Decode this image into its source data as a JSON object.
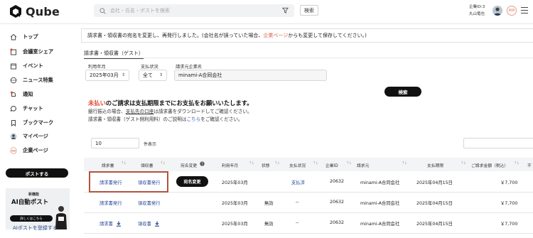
{
  "header": {
    "brand": "Qube",
    "search_placeholder": "会社・氏名・ポストを検索",
    "search_button": "検索",
    "company_line": "企業ID:3",
    "user_name": "丸山竜也",
    "avatar_initials": "AW"
  },
  "sidebar": {
    "items": [
      {
        "label": "トップ",
        "icon": "home-icon"
      },
      {
        "label": "会議室シェア",
        "icon": "meeting-room-icon"
      },
      {
        "label": "イベント",
        "icon": "calendar-icon"
      },
      {
        "label": "ニュース特集",
        "icon": "globe-icon"
      },
      {
        "label": "通知",
        "icon": "bell-icon"
      },
      {
        "label": "チャット",
        "icon": "chat-icon"
      },
      {
        "label": "ブックマーク",
        "icon": "bookmark-icon"
      },
      {
        "label": "マイページ",
        "icon": "user-icon"
      },
      {
        "label": "企業ページ",
        "icon": "company-icon"
      }
    ],
    "post_button": "ポストする",
    "banner_new": "新機能",
    "banner_title": "AI自動ポスト",
    "banner_cta": "詳しくはこちら",
    "banner_link": "AIポストを登録する"
  },
  "notice": {
    "text_before": "請求書・領収書の宛名を変更し、再発行しました。(会社名が誤っていた場合、",
    "link": "企業ページ",
    "text_after": "からも変更して保存してください。)"
  },
  "tab": "請求書・領収書（ゲスト）",
  "filters": {
    "month_label": "利用年月",
    "month_value": "2025年03月",
    "status_label": "支払状況",
    "status_value": "全て",
    "company_label": "請求元企業名",
    "company_value": "minami-A合同会社",
    "search_button": "検索"
  },
  "messages": {
    "line1_red": "未払い",
    "line1_rest": "のご請求は支払期限までにお支払をお願いいたします。",
    "line2_a": "銀行振込の場合、",
    "line2_link": "支払先の口座",
    "line2_b": "は請求書をダウンロードしてご確認ください。",
    "line3_a": "請求書・領収書（ゲスト側利用料）のご説明は",
    "line3_link": "こちら",
    "line3_b": "をご確認ください。"
  },
  "pagination": {
    "per_page": "10",
    "per_page_label": "件表示"
  },
  "table": {
    "headers": [
      "請求書",
      "領収書",
      "宛名変更",
      "利用年月",
      "状態",
      "支払状況",
      "企業ID",
      "請求元",
      "支払期限",
      "ご請求金額（税込）",
      "不"
    ],
    "rows": [
      {
        "invoice": "請求書発行",
        "receipt": "領収書発行",
        "rename": "宛名変更",
        "month": "2025年03月",
        "state": "",
        "payment": "支払済",
        "company_id": "20632",
        "issuer": "minami-A合同会社",
        "due": "2025年04月15日",
        "amount": "￥7,700"
      },
      {
        "invoice": "請求書発行",
        "receipt": "領収書発行",
        "rename": "",
        "month": "2025年03月",
        "state": "無効",
        "payment": "--",
        "company_id": "20632",
        "issuer": "minami-A合同会社",
        "due": "2025年04月15日",
        "amount": "￥7,700"
      },
      {
        "invoice": "請求書",
        "receipt": "領収書",
        "rename": "",
        "month": "2025年03月",
        "state": "無効",
        "payment": "--",
        "company_id": "20632",
        "issuer": "minami-A合同会社",
        "due": "2025年04月15日",
        "amount": "￥7,700"
      }
    ]
  },
  "colors": {
    "accent_red": "#e0452b",
    "link_blue": "#2b4b9a",
    "highlight_border": "#b0553d"
  }
}
